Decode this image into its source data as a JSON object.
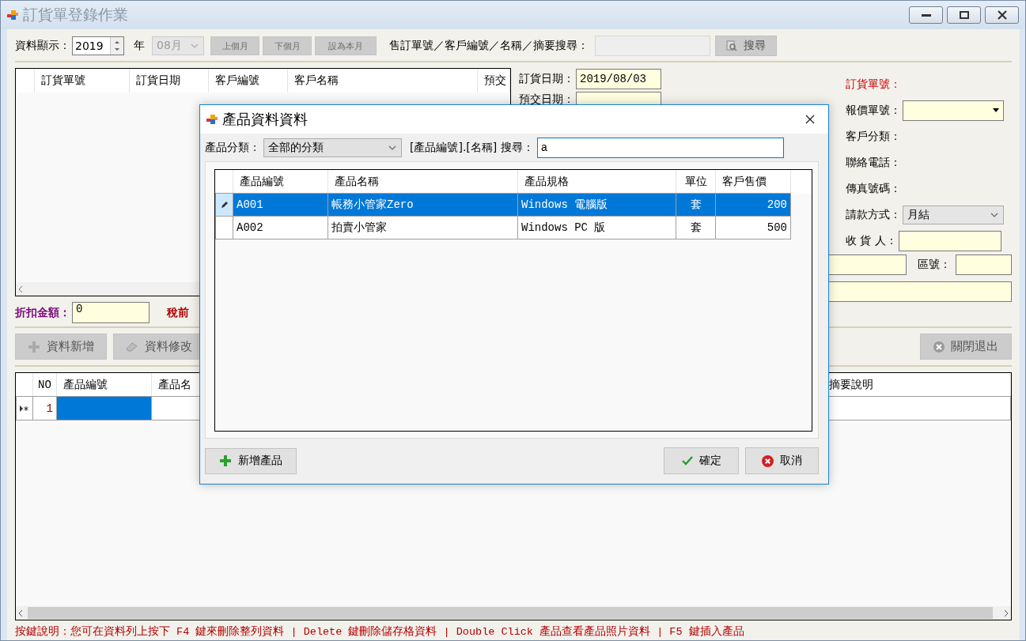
{
  "window": {
    "title": "訂貨單登錄作業"
  },
  "toolbar": {
    "label": "資料顯示：",
    "year": "2019",
    "year_unit": "年",
    "month": "08月",
    "month_disabled": true,
    "buttons": [
      {
        "label": "上個月",
        "disabled": true
      },
      {
        "label": "下個月",
        "disabled": true
      },
      {
        "label": "設為本月",
        "disabled": true
      }
    ],
    "search_label": "售訂單號／客戶編號／名稱／摘要搜尋：",
    "search_disabled": true,
    "search_button": {
      "label": "搜尋",
      "disabled": true
    }
  },
  "orders_table": {
    "columns": [
      "訂貨單號",
      "訂貨日期",
      "客戶編號",
      "客戶名稱",
      "預交"
    ]
  },
  "order_form": {
    "left": [
      {
        "label": "訂貨日期：",
        "value": "2019/08/03"
      },
      {
        "label": "預交日期："
      }
    ],
    "right": [
      {
        "kind": "text",
        "label": "訂貨單號：",
        "emphasis": true
      },
      {
        "kind": "combo",
        "label": "報價單號：",
        "emphasis": false
      },
      {
        "kind": "text",
        "label": "客戶分類：",
        "emphasis": false
      },
      {
        "kind": "text",
        "label": "聯絡電話：",
        "emphasis": false
      },
      {
        "kind": "text",
        "label": "傳真號碼：",
        "emphasis": false
      },
      {
        "kind": "select",
        "label": "請款方式：",
        "value": "月結",
        "emphasis": false
      },
      {
        "kind": "input",
        "label": "收 貨 人：",
        "emphasis": false
      }
    ],
    "zip_label": "區號："
  },
  "discount": {
    "label": "折扣金額：",
    "value": "0",
    "pretax_label": "稅前"
  },
  "actions": [
    {
      "label": "資料新增",
      "kind": "add",
      "disabled": true
    },
    {
      "label": "資料修改",
      "kind": "edit",
      "disabled": true
    }
  ],
  "close_button": {
    "label": "關閉退出",
    "disabled": true
  },
  "items_table": {
    "columns": [
      "NO",
      "產品編號",
      "產品名",
      "摘要說明"
    ],
    "rows": [
      {
        "no": "1",
        "code_selected": true
      }
    ]
  },
  "status_text": "按鍵說明：您可在資料列上按下 F4 鍵來刪除整列資料 | Delete 鍵刪除儲存格資料 | Double Click 產品查看產品照片資料 | F5 鍵插入產品",
  "dialog": {
    "title": "產品資料資料",
    "category_label": "產品分類：",
    "category": "全部的分類",
    "search_label": "[產品編號].[名稱] 搜尋：",
    "search_value": "a",
    "columns": [
      "產品編號",
      "產品名稱",
      "產品規格",
      "單位",
      "客戶售價"
    ],
    "rows": [
      {
        "code": "A001",
        "name": "帳務小管家Zero",
        "spec": "Windows 電腦版",
        "unit": "套",
        "price": "200",
        "selected": true,
        "editing": true
      },
      {
        "code": "A002",
        "name": "拍賣小管家",
        "spec": "Windows PC 版",
        "unit": "套",
        "price": "500",
        "selected": false,
        "editing": false
      }
    ],
    "add_button": "新增產品",
    "ok_button": "確定",
    "cancel_button": "取消"
  }
}
